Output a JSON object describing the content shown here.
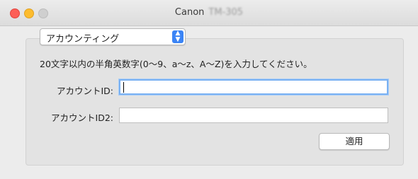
{
  "window": {
    "title": "Canon",
    "model_suffix": "TM-305"
  },
  "popup": {
    "selected": "アカウンティング",
    "stepper_up": "▲",
    "stepper_down": "▼"
  },
  "form": {
    "instruction": "20文字以内の半角英数字(0〜9、a〜z、A〜Z)を入力してください。",
    "account_id_label": "アカウントID:",
    "account_id_value": "",
    "account_id2_label": "アカウントID2:",
    "account_id2_value": "",
    "apply_label": "適用"
  },
  "colors": {
    "focus_ring": "#7ab1f2",
    "stepper": "#3b84f5",
    "close": "#fc5f57",
    "minimize": "#fdbc2e"
  }
}
